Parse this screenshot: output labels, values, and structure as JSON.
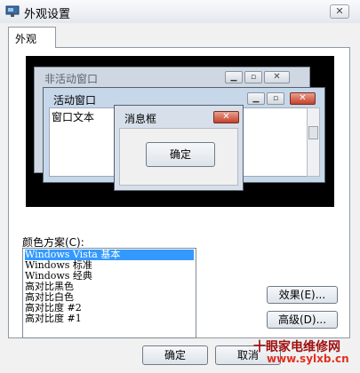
{
  "window": {
    "title": "外观设置",
    "close_glyph": "✕"
  },
  "tabs": [
    {
      "label": "外观",
      "selected": true
    }
  ],
  "preview": {
    "inactive_window_title": "非活动窗口",
    "active_window_title": "活动窗口",
    "window_text": "窗口文本",
    "message_box_title": "消息框",
    "message_box_ok": "确定",
    "min_glyph": "▁",
    "max_glyph": "▫",
    "close_glyph": "✕"
  },
  "color_scheme": {
    "label": "颜色方案(C):",
    "items": [
      {
        "label": "Windows Vista 基本",
        "selected": true
      },
      {
        "label": "Windows 标准"
      },
      {
        "label": "Windows 经典"
      },
      {
        "label": "高对比黑色"
      },
      {
        "label": "高对比白色"
      },
      {
        "label": "高对比度 #2"
      },
      {
        "label": "高对比度 #1"
      }
    ]
  },
  "buttons": {
    "effects": "效果(E)...",
    "advanced": "高级(D)...",
    "ok": "确定",
    "cancel": "取消"
  },
  "watermark": {
    "text": "十眼家电维修网",
    "url": "www.sylxb.cn"
  },
  "colors": {
    "selection": "#3399ff",
    "preview_bg": "#000000",
    "close_red": "#c4412b"
  }
}
